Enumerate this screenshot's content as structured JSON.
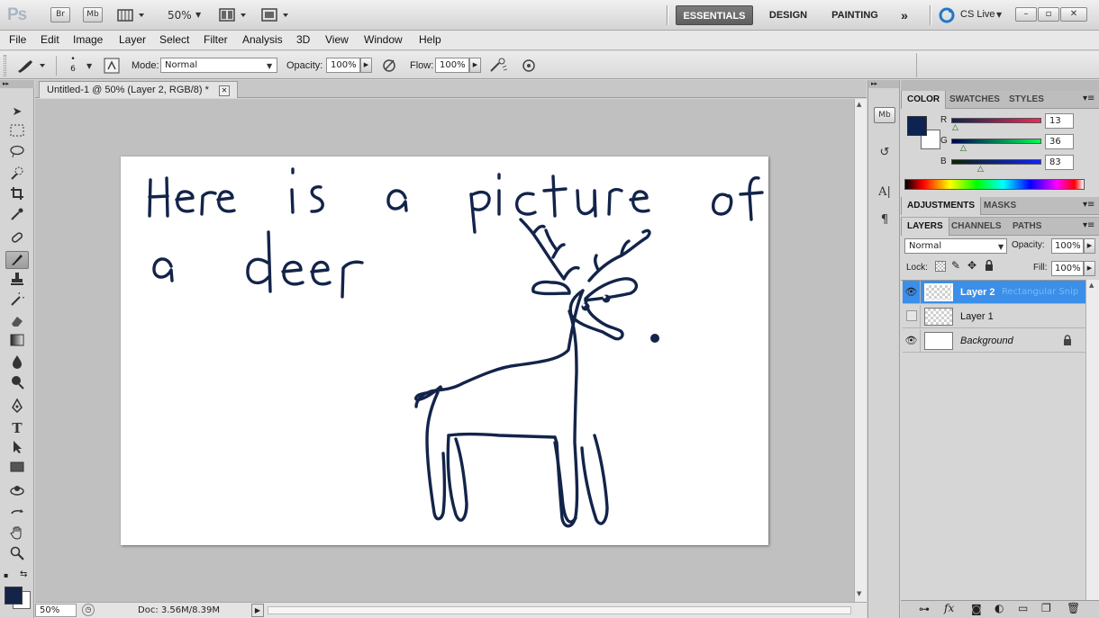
{
  "app": {
    "logo": "Ps",
    "bridge_label": "Br",
    "minibridge_label": "Mb",
    "zoom": "50%",
    "workspaces": [
      "ESSENTIALS",
      "DESIGN",
      "PAINTING"
    ],
    "more_workspaces": "»",
    "cs_live": "CS Live",
    "window_controls": {
      "minimize": "–",
      "restore": "▫",
      "close": "✕"
    }
  },
  "menu": [
    "File",
    "Edit",
    "Image",
    "Layer",
    "Select",
    "Filter",
    "Analysis",
    "3D",
    "View",
    "Window",
    "Help"
  ],
  "options": {
    "brush_size": "6",
    "mode_label": "Mode:",
    "mode_value": "Normal",
    "opacity_label": "Opacity:",
    "opacity_value": "100%",
    "flow_label": "Flow:",
    "flow_value": "100%"
  },
  "document": {
    "tab_title": "Untitled-1 @ 50% (Layer 2, RGB/8) *",
    "close_glyph": "✕",
    "status_zoom": "50%",
    "status_doc": "Doc: 3.56M/8.39M"
  },
  "color_panel": {
    "tabs": [
      "COLOR",
      "SWATCHES",
      "STYLES"
    ],
    "foreground": "#0d2453",
    "background": "#ffffff",
    "channels": [
      {
        "label": "R",
        "value": "13"
      },
      {
        "label": "G",
        "value": "36"
      },
      {
        "label": "B",
        "value": "83"
      }
    ]
  },
  "adjustments_panel": {
    "tabs": [
      "ADJUSTMENTS",
      "MASKS"
    ]
  },
  "layers_panel": {
    "tabs": [
      "LAYERS",
      "CHANNELS",
      "PATHS"
    ],
    "blend_mode": "Normal",
    "opacity_label": "Opacity:",
    "opacity_value": "100%",
    "lock_label": "Lock:",
    "fill_label": "Fill:",
    "fill_value": "100%",
    "layers": [
      {
        "name": "Layer 2",
        "tooltip": "Rectangular Snip",
        "visible": true,
        "selected": true
      },
      {
        "name": "Layer 1",
        "visible": false,
        "selected": false
      },
      {
        "name": "Background",
        "visible": true,
        "selected": false,
        "locked": true
      }
    ]
  },
  "colors": {
    "ink": "#13244a",
    "selection": "#3b8fe8",
    "workspace": "#c0c0c0"
  }
}
